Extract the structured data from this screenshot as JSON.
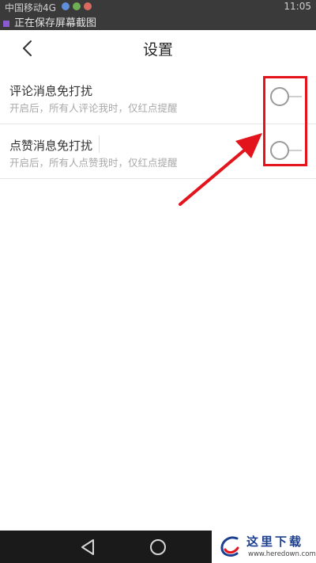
{
  "status_bar": {
    "carrier": "中国移动4G",
    "time": "11:05",
    "notification": "正在保存屏幕截图"
  },
  "header": {
    "title": "设置",
    "back_icon": "chevron-left-icon"
  },
  "settings": [
    {
      "title": "评论消息免打扰",
      "description": "开启后，所有人评论我时，仅红点提醒",
      "enabled": false
    },
    {
      "title": "点赞消息免打扰",
      "description": "开启后，所有人点赞我时，仅红点提醒",
      "enabled": false
    }
  ],
  "annotation": {
    "color": "#e3141c"
  },
  "nav_bar": {
    "back_icon": "triangle-back-icon",
    "home_icon": "circle-home-icon"
  },
  "watermark": {
    "title": "这里下载",
    "url": "www.heredown.com"
  }
}
